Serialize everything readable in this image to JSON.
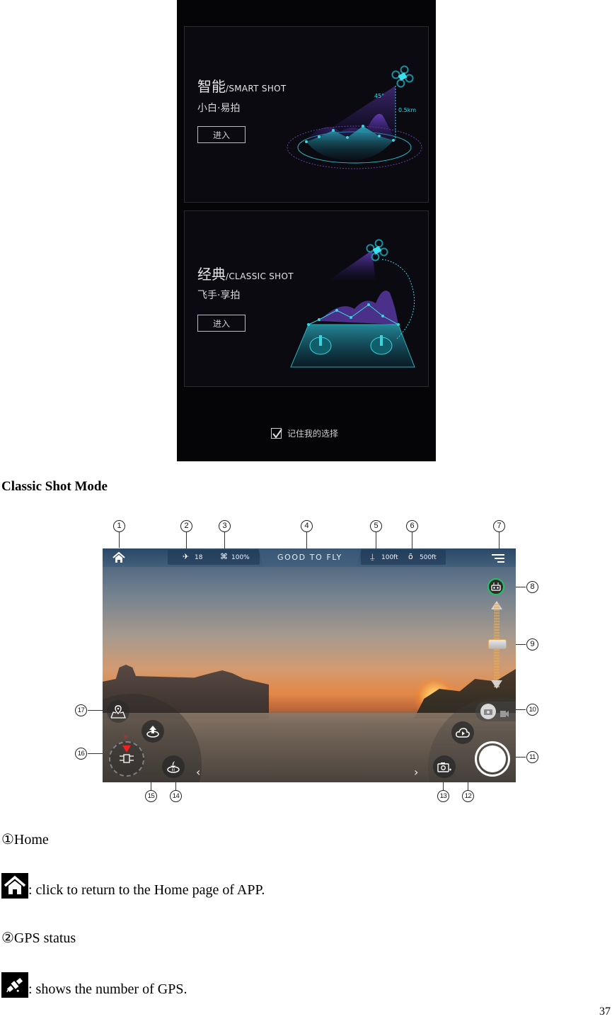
{
  "mode_select": {
    "smart": {
      "title_cn": "智能",
      "title_en": "/SMART SHOT",
      "subtitle": "小白·易拍",
      "enter_label": "进入",
      "angle_label": "45°",
      "distance_label": "0.5km"
    },
    "classic": {
      "title_cn": "经典",
      "title_en": "/CLASSIC SHOT",
      "subtitle": "飞手·享拍",
      "enter_label": "进入"
    },
    "remember_label": "记住我的选择",
    "remember_checked": true
  },
  "section_heading": "Classic Shot Mode",
  "fly_screen": {
    "gps_count": "18",
    "battery": "100%",
    "status": "GOOD TO FLY",
    "altitude": "100ft",
    "distance": "500ft",
    "remote_signal_color": "#22c55e",
    "prev_arrow": "‹",
    "next_arrow": "›"
  },
  "callouts": [
    "①",
    "②",
    "③",
    "④",
    "⑤",
    "⑥",
    "⑦",
    "⑧",
    "⑨",
    "⑩",
    "⑪",
    "⑫",
    "⑬",
    "⑭",
    "⑮",
    "⑯",
    "⑰"
  ],
  "callout_numbers": [
    "1",
    "2",
    "3",
    "4",
    "5",
    "6",
    "7",
    "8",
    "9",
    "10",
    "11",
    "12",
    "13",
    "14",
    "15",
    "16",
    "17"
  ],
  "descriptions": [
    {
      "heading": "①Home",
      "icon": "home-icon",
      "text": ": click to return to the Home page of APP."
    },
    {
      "heading": "②GPS status",
      "icon": "gps-satellite-icon",
      "text": ": shows the number of GPS."
    }
  ],
  "page_number": "37"
}
